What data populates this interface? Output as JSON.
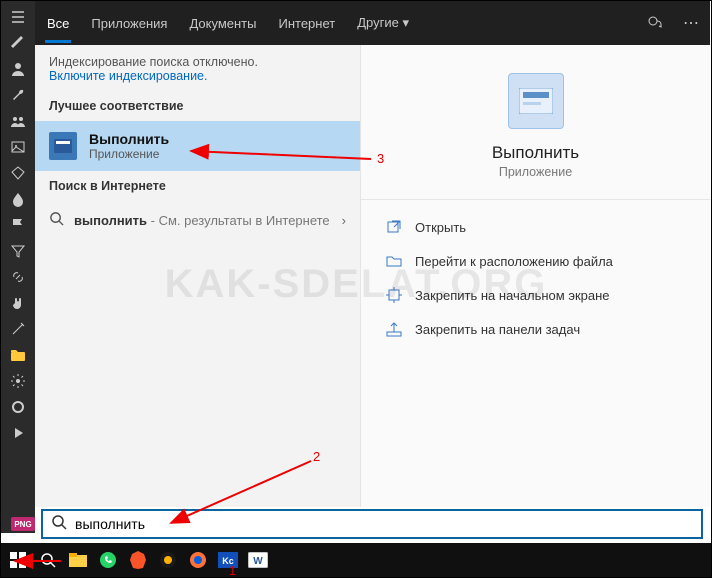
{
  "watermark": "KAK-SDELAT.ORG",
  "tabs": {
    "all": "Все",
    "apps": "Приложения",
    "docs": "Документы",
    "web": "Интернет",
    "other": "Другие"
  },
  "notice": {
    "line": "Индексирование поиска отключено.",
    "link": "Включите индексирование."
  },
  "sections": {
    "best": "Лучшее соответствие",
    "websearch": "Поиск в Интернете"
  },
  "bestMatch": {
    "title": "Выполнить",
    "subtitle": "Приложение"
  },
  "webRow": {
    "query": "выполнить",
    "suffix": " - См. результаты в Интернете"
  },
  "preview": {
    "title": "Выполнить",
    "subtitle": "Приложение"
  },
  "actions": {
    "open": "Открыть",
    "location": "Перейти к расположению файла",
    "pinStart": "Закрепить на начальном экране",
    "pinTaskbar": "Закрепить на панели задач"
  },
  "search": {
    "value": "выполнить"
  },
  "annot": {
    "n1": "1",
    "n2": "2",
    "n3": "3"
  },
  "png": "PNG"
}
